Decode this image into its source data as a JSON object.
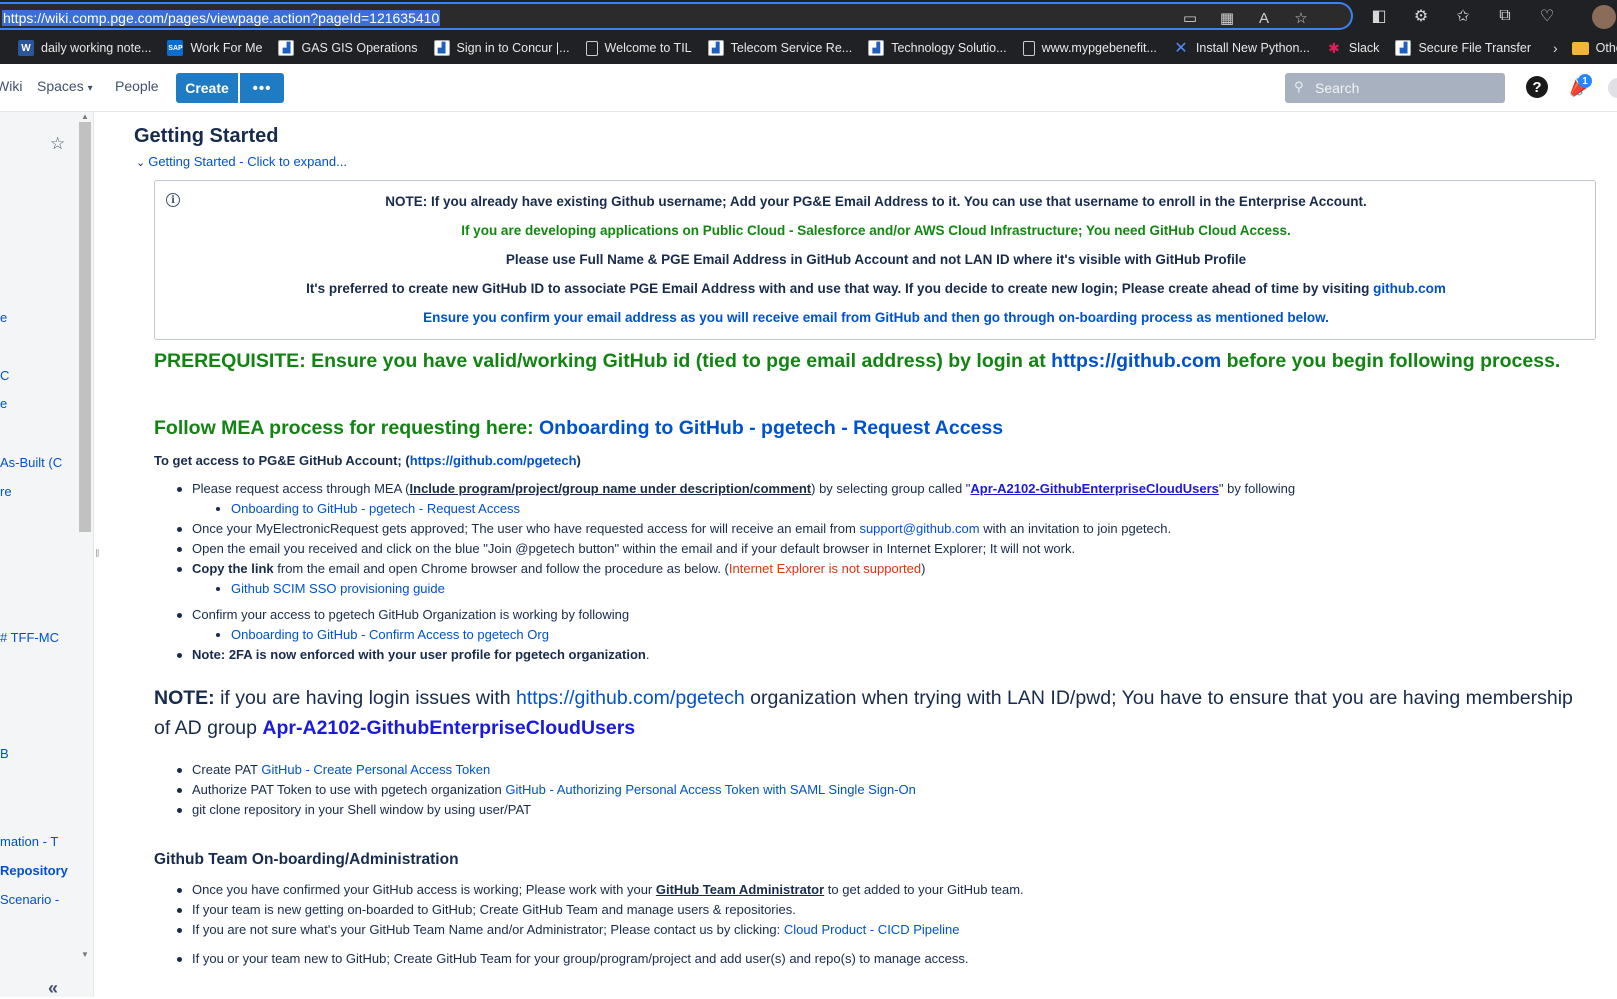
{
  "browser": {
    "url": "https://wiki.comp.pge.com/pages/viewpage.action?pageId=121635410",
    "bookmarks": [
      {
        "label": "daily working note...",
        "icon": "word-icon"
      },
      {
        "label": "Work For Me",
        "icon": "sap-icon"
      },
      {
        "label": "GAS GIS Operations",
        "icon": "chart-icon"
      },
      {
        "label": "Sign in to Concur |...",
        "icon": "chart-icon"
      },
      {
        "label": "Welcome to TIL",
        "icon": "page-icon"
      },
      {
        "label": "Telecom Service Re...",
        "icon": "chart-icon"
      },
      {
        "label": "Technology Solutio...",
        "icon": "chart-icon"
      },
      {
        "label": "www.mypgebenefit...",
        "icon": "page-icon"
      },
      {
        "label": "Install New Python...",
        "icon": "confluence-icon"
      },
      {
        "label": "Slack",
        "icon": "slack-icon"
      },
      {
        "label": "Secure File Transfer",
        "icon": "chart-icon"
      }
    ],
    "other_bookmarks": "Other"
  },
  "header": {
    "wiki": "Wiki",
    "spaces": "Spaces",
    "people": "People",
    "create": "Create",
    "more": "•••",
    "search_placeholder": "Search",
    "help": "?",
    "notification_count": "1"
  },
  "sidebar": {
    "items": [
      {
        "label": "e",
        "bold": false
      },
      {
        "label": "C",
        "bold": false
      },
      {
        "label": "e",
        "bold": false
      },
      {
        "label": "As-Built (C",
        "bold": false
      },
      {
        "label": "re",
        "bold": false
      },
      {
        "label": "# TFF-MC",
        "bold": false
      },
      {
        "label": "B",
        "bold": false
      },
      {
        "label": "mation - T",
        "bold": false
      },
      {
        "label": "Repository",
        "bold": true
      },
      {
        "label": "Scenario -",
        "bold": false
      }
    ],
    "collapse": "«"
  },
  "page": {
    "title": "Getting Started",
    "expand": "Getting Started - Click to expand...",
    "info": {
      "line1": "NOTE: If you already have existing Github username; Add your PG&E Email Address to it. You can use that username to enroll in the Enterprise Account.",
      "line2": "If you are developing applications on Public Cloud - Salesforce and/or AWS Cloud Infrastructure; You need GitHub Cloud Access.",
      "line3": "Please use Full Name & PGE Email Address in GitHub Account and not LAN ID where it's visible with GitHub Profile",
      "line4_text": "It's preferred to create new GitHub ID to associate PGE Email Address with and use that way. If you decide to create new login; Please create ahead of time by visiting",
      "line4_link": "github.com",
      "line5": "Ensure you confirm your email address as you will receive email from GitHub and then go through on-boarding process as mentioned below."
    },
    "prereq": {
      "text1": "PREREQUISITE: Ensure you have valid/working GitHub id (tied to pge email address) by login at",
      "link": "https://github.com",
      "text2": "before you begin following process."
    },
    "follow": {
      "text": "Follow MEA process for requesting here:",
      "link": "Onboarding to GitHub - pgetech - Request Access"
    },
    "access": {
      "text": "To get access to PG&E GitHub Account; (",
      "link": "https://github.com/pgetech",
      "close": ")"
    },
    "steps": {
      "s1_a": "Please request access through MEA (",
      "s1_u": "Include program/project/group name under description/comment",
      "s1_b": ") by selecting group called \"",
      "s1_grp": "Apr-A2102-GithubEnterpriseCloudUsers",
      "s1_c": "\" by following",
      "s1_sub": "Onboarding to GitHub - pgetech - Request Access",
      "s2_a": "Once your MyElectronicRequest gets approved; The user who have requested access for will receive an email from",
      "s2_link": "support@github.com",
      "s2_b": "with an invitation to join pgetech.",
      "s3": "Open the email you received and click on the blue \"Join @pgetech button\" within the email and if your default browser in Internet Explorer; It will not work.",
      "s4_bold": "Copy the link",
      "s4_a": "from the email and open Chrome browser and follow the procedure as below. (",
      "s4_red": "Internet Explorer is not supported",
      "s4_b": ")",
      "s4_sub": "Github SCIM SSO provisioning guide",
      "s5": "Confirm your access to pgetech GitHub Organization is working by following",
      "s5_sub": "Onboarding to GitHub - Confirm Access to pgetech Org",
      "s6_bold": "Note: 2FA is now enforced with your user profile for pgetech organization",
      "s6_end": "."
    },
    "login_note": {
      "bold": "NOTE:",
      "a": "if you are having login issues with",
      "link": "https://github.com/pgetech",
      "b": "organization when trying with LAN ID/pwd; You have to ensure that you are having membership of AD group",
      "grp": "Apr-A2102-GithubEnterpriseCloudUsers"
    },
    "pat": {
      "p1_a": "Create PAT",
      "p1_link": "GitHub - Create Personal Access Token",
      "p2_a": "Authorize PAT Token to use with pgetech organization",
      "p2_link": "GitHub - Authorizing Personal Access Token with SAML Single Sign-On",
      "p3": "git clone repository in your Shell window by using user/PAT"
    },
    "team": {
      "heading": "Github Team On-boarding/Administration",
      "t1_a": "Once you have confirmed your GitHub access is working; Please work with your",
      "t1_u": "GitHub Team Administrator",
      "t1_b": "to get added to your GitHub team.",
      "t2": "If your team is new getting on-boarded to GitHub; Create GitHub Team and manage users & repositories.",
      "t3_a": "If you are not sure what's your GitHub Team Name and/or Administrator; Please contact us by clicking:",
      "t3_link": "Cloud Product - CICD Pipeline",
      "t4": "If you or your team new to GitHub; Create GitHub Team for your group/program/project and add user(s) and repo(s) to manage access."
    }
  }
}
